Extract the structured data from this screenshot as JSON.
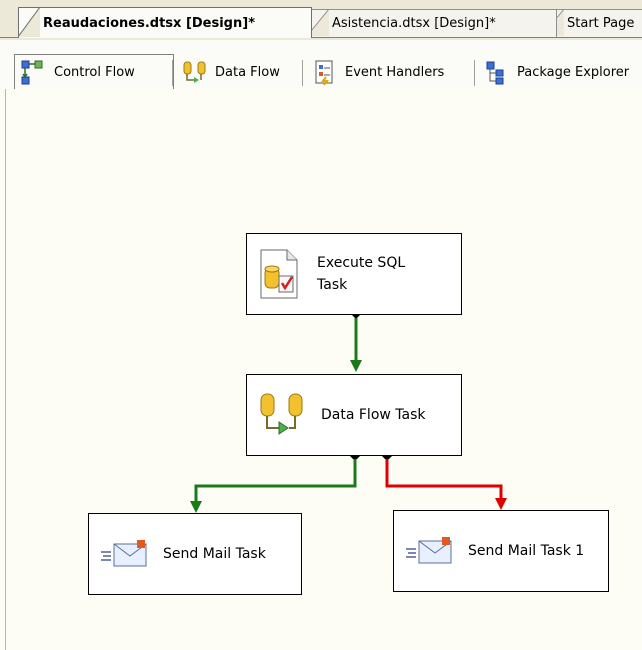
{
  "document_tabs": [
    {
      "label": "Reaudaciones.dtsx [Design]*",
      "active": true
    },
    {
      "label": "Asistencia.dtsx [Design]*",
      "active": false
    },
    {
      "label": "Start Page",
      "active": false
    }
  ],
  "designer_tabs": [
    {
      "label": "Control Flow",
      "icon": "control-flow-icon",
      "active": true
    },
    {
      "label": "Data Flow",
      "icon": "data-flow-icon",
      "active": false
    },
    {
      "label": "Event Handlers",
      "icon": "event-handlers-icon",
      "active": false
    },
    {
      "label": "Package Explorer",
      "icon": "package-explorer-icon",
      "active": false
    }
  ],
  "tasks": {
    "execute_sql": {
      "label": "Execute SQL Task",
      "icon": "execute-sql-icon"
    },
    "data_flow": {
      "label": "Data Flow Task",
      "icon": "data-flow-task-icon"
    },
    "send_mail": {
      "label": "Send Mail Task",
      "icon": "send-mail-icon"
    },
    "send_mail_1": {
      "label": "Send Mail Task 1",
      "icon": "send-mail-icon"
    }
  },
  "colors": {
    "success": "#1a7a1a",
    "failure": "#e00000",
    "canvas": "#fdfdf5"
  }
}
